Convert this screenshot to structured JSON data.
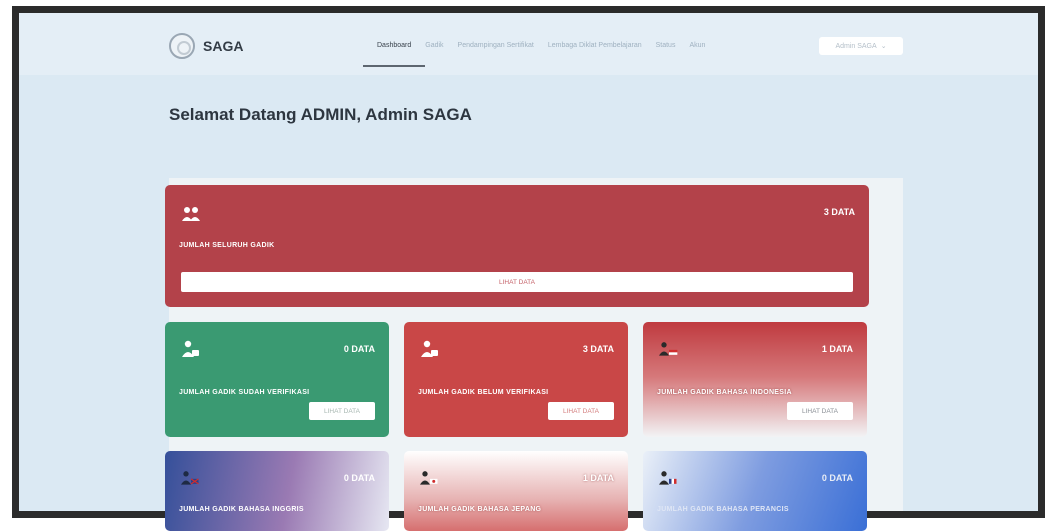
{
  "brand": {
    "name": "SAGA"
  },
  "nav": {
    "items": [
      {
        "label": "Dashboard",
        "active": true
      },
      {
        "label": "Gadik",
        "active": false
      },
      {
        "label": "Pendampingan Sertifikat",
        "active": false
      },
      {
        "label": "Lembaga Diklat Pembelajaran",
        "active": false
      },
      {
        "label": "Status",
        "active": false
      },
      {
        "label": "Akun",
        "active": false
      }
    ],
    "user_button": "Admin SAGA",
    "user_caret": "⌄"
  },
  "welcome": "Selamat Datang ADMIN, Admin SAGA",
  "cards": {
    "total": {
      "count": "3 DATA",
      "title": "JUMLAH SELURUH GADIK",
      "button": "LIHAT DATA",
      "color": "#b3424a"
    },
    "verified": {
      "count": "0 DATA",
      "title": "JUMLAH GADIK SUDAH VERIFIKASI",
      "button": "LIHAT DATA",
      "color": "#3a9a72"
    },
    "unverified": {
      "count": "3 DATA",
      "title": "JUMLAH GADIK BELUM VERIFIKASI",
      "button": "LIHAT DATA",
      "color": "#c94747"
    },
    "indonesian": {
      "count": "1 DATA",
      "title": "JUMLAH GADIK BAHASA INDONESIA",
      "button": "LIHAT DATA"
    },
    "english": {
      "count": "0 DATA",
      "title": "JUMLAH GADIK BAHASA INGGRIS"
    },
    "japanese": {
      "count": "1 DATA",
      "title": "JUMLAH GADIK BAHASA JEPANG"
    },
    "other": {
      "count": "0 DATA",
      "title": "JUMLAH GADIK BAHASA PERANCIS"
    }
  },
  "icons": {
    "brand": "logo-emblem",
    "total": "users-group-icon",
    "verified": "user-check-icon",
    "unverified": "user-pending-icon",
    "indonesian": "user-flag-icon",
    "english": "user-flag-icon",
    "japanese": "user-flag-icon",
    "other": "user-flag-icon"
  }
}
